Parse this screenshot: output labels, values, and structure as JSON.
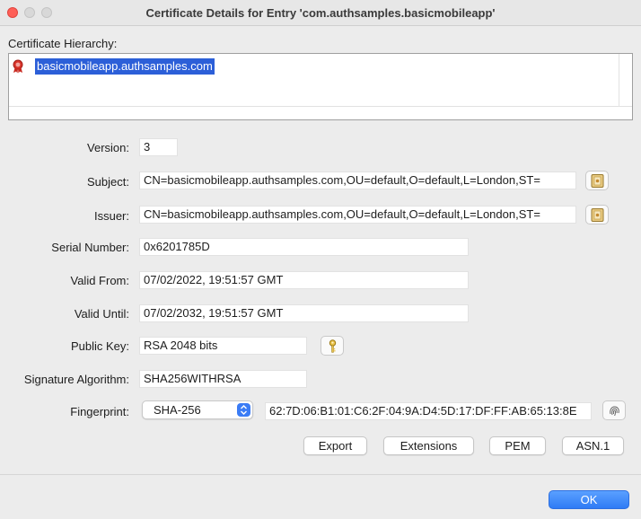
{
  "window": {
    "title": "Certificate Details for Entry 'com.authsamples.basicmobileapp'"
  },
  "hierarchy": {
    "label": "Certificate Hierarchy:",
    "selected_entry": "basicmobileapp.authsamples.com"
  },
  "fields": {
    "version": {
      "label": "Version:",
      "value": "3"
    },
    "subject": {
      "label": "Subject:",
      "value": "CN=basicmobileapp.authsamples.com,OU=default,O=default,L=London,ST="
    },
    "issuer": {
      "label": "Issuer:",
      "value": "CN=basicmobileapp.authsamples.com,OU=default,O=default,L=London,ST="
    },
    "serial": {
      "label": "Serial Number:",
      "value": "0x6201785D"
    },
    "valid_from": {
      "label": "Valid From:",
      "value": "07/02/2022, 19:51:57 GMT"
    },
    "valid_until": {
      "label": "Valid Until:",
      "value": "07/02/2032, 19:51:57 GMT"
    },
    "public_key": {
      "label": "Public Key:",
      "value": "RSA 2048 bits"
    },
    "sig_alg": {
      "label": "Signature Algorithm:",
      "value": "SHA256WITHRSA"
    },
    "fingerprint": {
      "label": "Fingerprint:",
      "algorithm": "SHA-256",
      "value": "62:7D:06:B1:01:C6:2F:04:9A:D4:5D:17:DF:FF:AB:65:13:8E"
    }
  },
  "buttons": {
    "export": "Export",
    "extensions": "Extensions",
    "pem": "PEM",
    "asn1": "ASN.1",
    "ok": "OK"
  },
  "icons": {
    "certificate": "certificate-ribbon-icon",
    "subject_details": "details-icon",
    "issuer_details": "details-icon",
    "public_key": "key-icon",
    "fingerprint": "fingerprint-icon"
  },
  "colors": {
    "selection": "#2c5fd8",
    "accent": "#3b7cf5",
    "close": "#fe5f57"
  }
}
